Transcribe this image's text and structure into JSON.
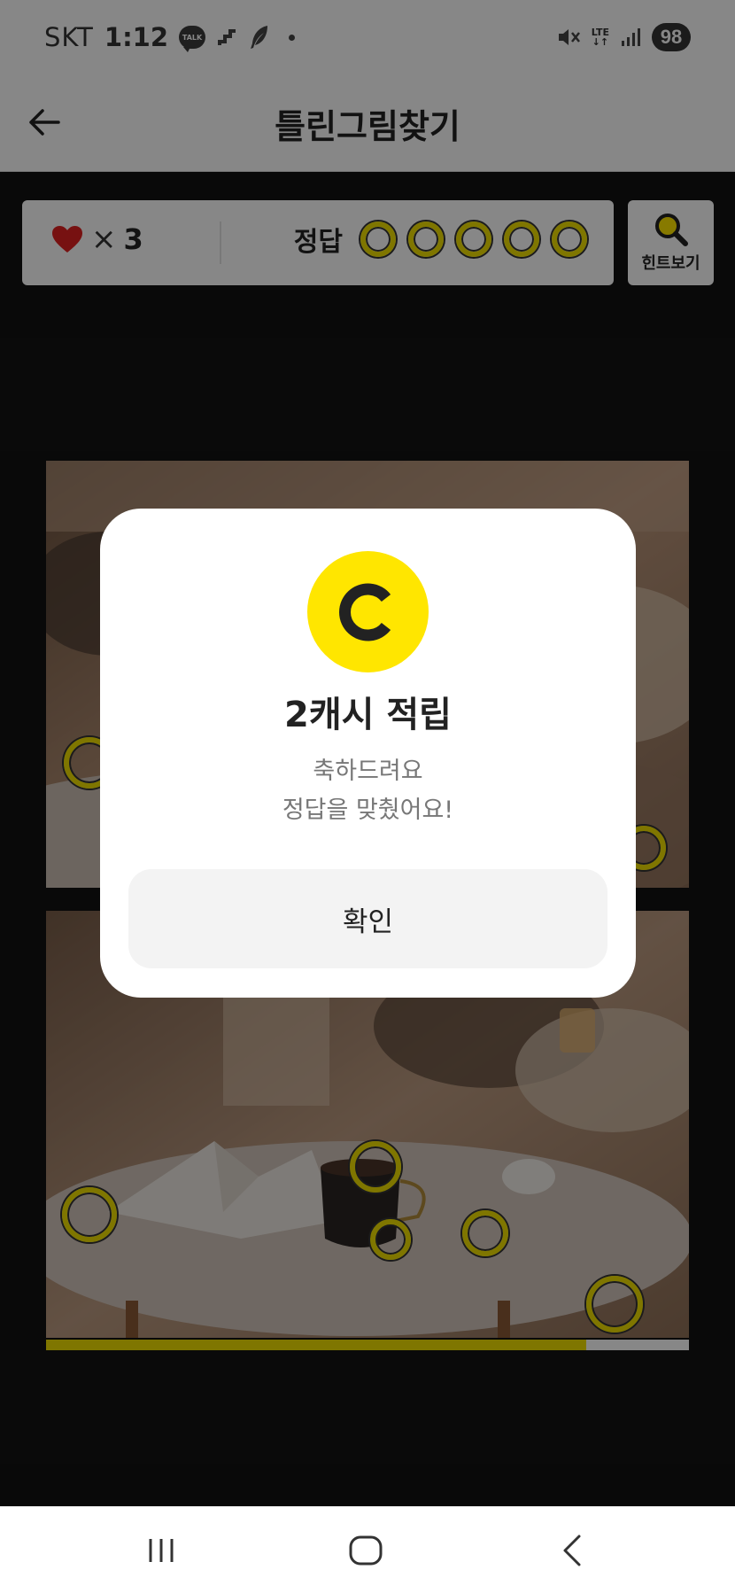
{
  "status_bar": {
    "carrier": "SKT",
    "time": "1:12",
    "talk_icon_text": "TALK",
    "network": "LTE",
    "battery": "98"
  },
  "app_bar": {
    "title": "틀린그림찾기"
  },
  "game": {
    "lives_count": "3",
    "lives_separator": "×",
    "answers_label": "정답",
    "answers_total": 5,
    "answers_found": 0,
    "hint_label": "힌트보기",
    "progress": 0.84
  },
  "modal": {
    "coin_letter": "C",
    "title": "2캐시 적립",
    "message_line1": "축하드려요",
    "message_line2": "정답을 맞췄어요!",
    "confirm_label": "확인"
  },
  "colors": {
    "accent_yellow": "#ffe600",
    "marker_yellow": "#f0df00",
    "heart_red": "#e02020",
    "overlay": "rgba(0,0,0,0.47)"
  },
  "icons": [
    "back-arrow-icon",
    "heart-icon",
    "magnifier-icon",
    "coin-icon",
    "recents-icon",
    "home-icon",
    "nav-back-icon"
  ]
}
